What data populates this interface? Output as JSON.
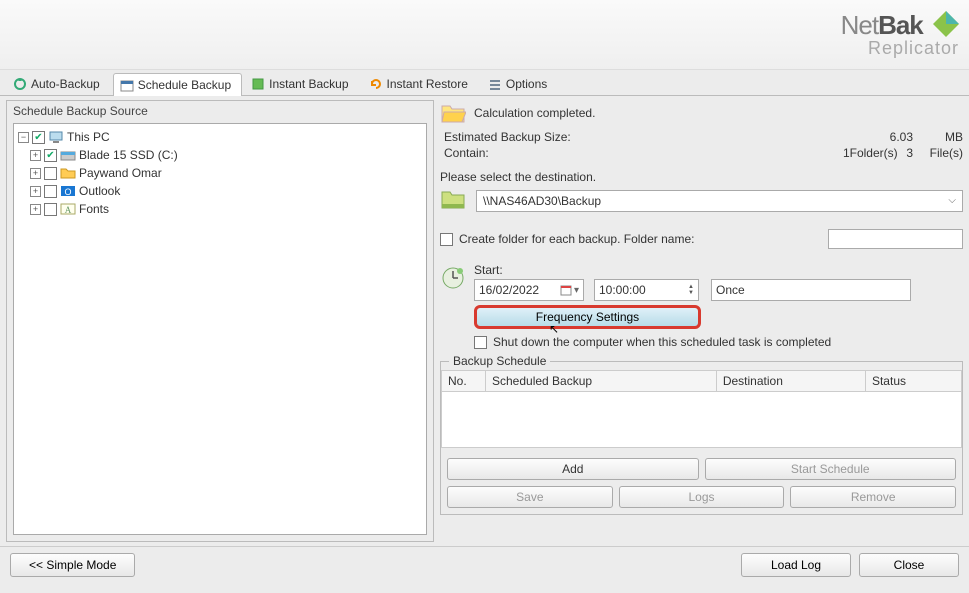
{
  "logo": {
    "line1a": "Net",
    "line1b": "Bak",
    "line2": "Replicator"
  },
  "tabs": {
    "auto": "Auto-Backup",
    "schedule": "Schedule Backup",
    "instant": "Instant Backup",
    "restore": "Instant Restore",
    "options": "Options"
  },
  "left": {
    "title": "Schedule Backup Source",
    "tree": {
      "thispc": "This PC",
      "blade": "Blade 15 SSD (C:)",
      "paywand": "Paywand Omar",
      "outlook": "Outlook",
      "fonts": "Fonts"
    }
  },
  "right": {
    "calc_done": "Calculation completed.",
    "est_label": "Estimated Backup Size:",
    "est_val": "6.03",
    "est_unit": "MB",
    "contain_label": "Contain:",
    "folders_count": "1",
    "folders_label": "Folder(s)",
    "files_count": "3",
    "files_label": "File(s)",
    "dest_prompt": "Please select the destination.",
    "dest_value": "\\\\NAS46AD30\\Backup",
    "create_folder_label": "Create folder for each backup. Folder name:",
    "folder_name_value": "",
    "start_label": "Start:",
    "date_value": "16/02/2022",
    "time_value": "10:00:00",
    "freq_value": "Once",
    "freq_btn": "Frequency Settings",
    "shutdown_label": "Shut down the computer when this scheduled task is completed",
    "bs_legend": "Backup Schedule",
    "cols": {
      "no": "No.",
      "scheduled": "Scheduled Backup",
      "dest": "Destination",
      "status": "Status"
    },
    "btns": {
      "add": "Add",
      "start": "Start Schedule",
      "save": "Save",
      "logs": "Logs",
      "remove": "Remove"
    }
  },
  "footer": {
    "simple": "<< Simple Mode",
    "loadlog": "Load Log",
    "close": "Close"
  }
}
